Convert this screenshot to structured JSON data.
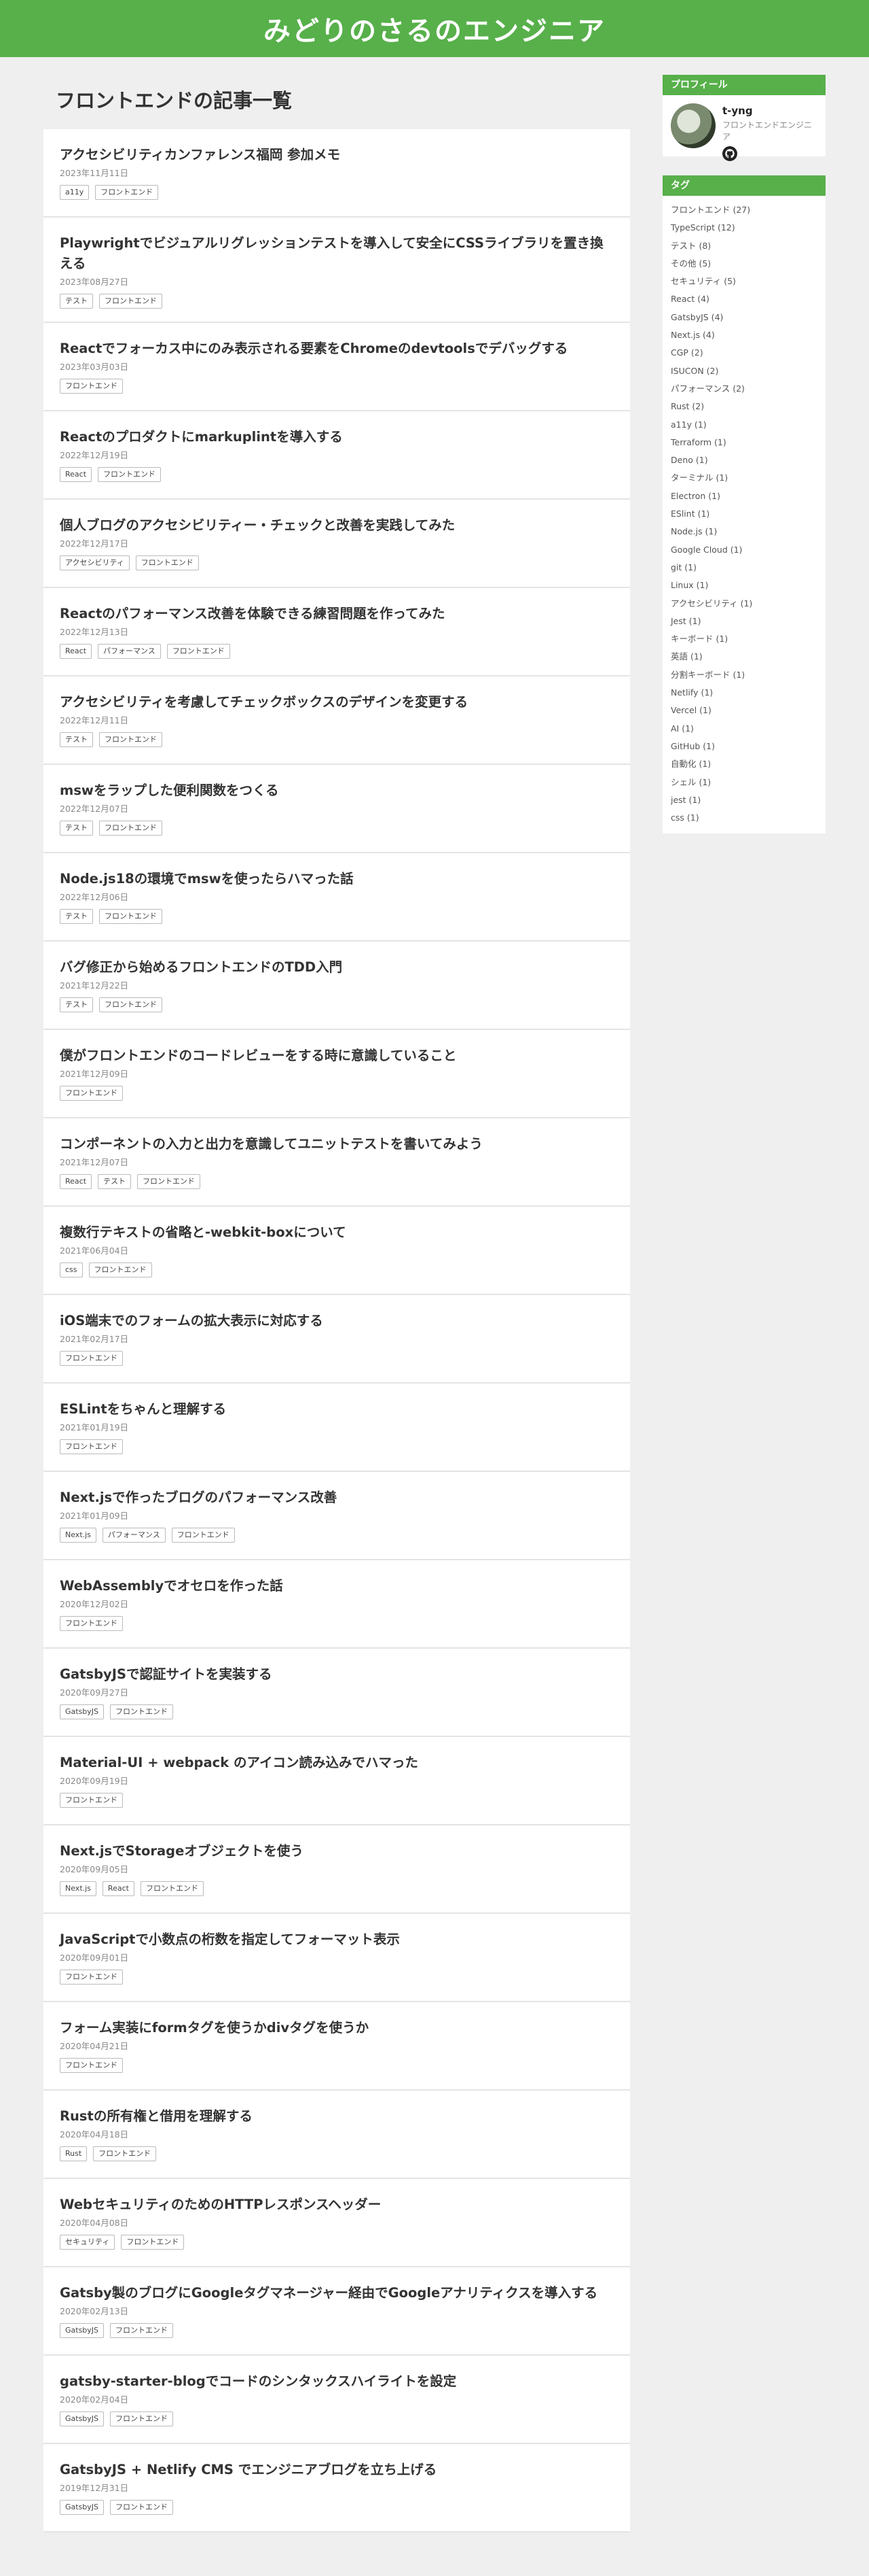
{
  "site": {
    "title": "みどりのさるのエンジニア",
    "accent": "#57b04a"
  },
  "main": {
    "heading": "フロントエンドの記事一覧",
    "articles": [
      {
        "title": "アクセシビリティカンファレンス福岡 参加メモ",
        "date": "2023年11月11日",
        "tags": [
          "a11y",
          "フロントエンド"
        ]
      },
      {
        "title": "Playwrightでビジュアルリグレッションテストを導入して安全にCSSライブラリを置き換える",
        "date": "2023年08月27日",
        "tags": [
          "テスト",
          "フロントエンド"
        ],
        "tall": true
      },
      {
        "title": "Reactでフォーカス中にのみ表示される要素をChromeのdevtoolsでデバッグする",
        "date": "2023年03月03日",
        "tags": [
          "フロントエンド"
        ]
      },
      {
        "title": "Reactのプロダクトにmarkuplintを導入する",
        "date": "2022年12月19日",
        "tags": [
          "React",
          "フロントエンド"
        ]
      },
      {
        "title": "個人ブログのアクセシビリティー・チェックと改善を実践してみた",
        "date": "2022年12月17日",
        "tags": [
          "アクセシビリティ",
          "フロントエンド"
        ]
      },
      {
        "title": "Reactのパフォーマンス改善を体験できる練習問題を作ってみた",
        "date": "2022年12月13日",
        "tags": [
          "React",
          "パフォーマンス",
          "フロントエンド"
        ]
      },
      {
        "title": "アクセシビリティを考慮してチェックボックスのデザインを変更する",
        "date": "2022年12月11日",
        "tags": [
          "テスト",
          "フロントエンド"
        ]
      },
      {
        "title": "mswをラップした便利関数をつくる",
        "date": "2022年12月07日",
        "tags": [
          "テスト",
          "フロントエンド"
        ]
      },
      {
        "title": "Node.js18の環境でmswを使ったらハマった話",
        "date": "2022年12月06日",
        "tags": [
          "テスト",
          "フロントエンド"
        ]
      },
      {
        "title": "バグ修正から始めるフロントエンドのTDD入門",
        "date": "2021年12月22日",
        "tags": [
          "テスト",
          "フロントエンド"
        ]
      },
      {
        "title": "僕がフロントエンドのコードレビューをする時に意識していること",
        "date": "2021年12月09日",
        "tags": [
          "フロントエンド"
        ]
      },
      {
        "title": "コンポーネントの入力と出力を意識してユニットテストを書いてみよう",
        "date": "2021年12月07日",
        "tags": [
          "React",
          "テスト",
          "フロントエンド"
        ]
      },
      {
        "title": "複数行テキストの省略と-webkit-boxについて",
        "date": "2021年06月04日",
        "tags": [
          "css",
          "フロントエンド"
        ]
      },
      {
        "title": "iOS端末でのフォームの拡大表示に対応する",
        "date": "2021年02月17日",
        "tags": [
          "フロントエンド"
        ]
      },
      {
        "title": "ESLintをちゃんと理解する",
        "date": "2021年01月19日",
        "tags": [
          "フロントエンド"
        ]
      },
      {
        "title": "Next.jsで作ったブログのパフォーマンス改善",
        "date": "2021年01月09日",
        "tags": [
          "Next.js",
          "パフォーマンス",
          "フロントエンド"
        ]
      },
      {
        "title": "WebAssemblyでオセロを作った話",
        "date": "2020年12月02日",
        "tags": [
          "フロントエンド"
        ]
      },
      {
        "title": "GatsbyJSで認証サイトを実装する",
        "date": "2020年09月27日",
        "tags": [
          "GatsbyJS",
          "フロントエンド"
        ]
      },
      {
        "title": "Material-UI + webpack のアイコン読み込みでハマった",
        "date": "2020年09月19日",
        "tags": [
          "フロントエンド"
        ]
      },
      {
        "title": "Next.jsでStorageオブジェクトを使う",
        "date": "2020年09月05日",
        "tags": [
          "Next.js",
          "React",
          "フロントエンド"
        ]
      },
      {
        "title": "JavaScriptで小数点の桁数を指定してフォーマット表示",
        "date": "2020年09月01日",
        "tags": [
          "フロントエンド"
        ]
      },
      {
        "title": "フォーム実装にformタグを使うかdivタグを使うか",
        "date": "2020年04月21日",
        "tags": [
          "フロントエンド"
        ]
      },
      {
        "title": "Rustの所有権と借用を理解する",
        "date": "2020年04月18日",
        "tags": [
          "Rust",
          "フロントエンド"
        ]
      },
      {
        "title": "WebセキュリティのためのHTTPレスポンスヘッダー",
        "date": "2020年04月08日",
        "tags": [
          "セキュリティ",
          "フロントエンド"
        ]
      },
      {
        "title": "Gatsby製のブログにGoogleタグマネージャー経由でGoogleアナリティクスを導入する",
        "date": "2020年02月13日",
        "tags": [
          "GatsbyJS",
          "フロントエンド"
        ]
      },
      {
        "title": "gatsby-starter-blogでコードのシンタックスハイライトを設定",
        "date": "2020年02月04日",
        "tags": [
          "GatsbyJS",
          "フロントエンド"
        ]
      },
      {
        "title": "GatsbyJS + Netlify CMS でエンジニアブログを立ち上げる",
        "date": "2019年12月31日",
        "tags": [
          "GatsbyJS",
          "フロントエンド"
        ]
      }
    ]
  },
  "sidebar": {
    "profile": {
      "heading": "プロフィール",
      "name": "t-yng",
      "role": "フロントエンドエンジニア",
      "icon": "github-icon"
    },
    "tags": {
      "heading": "タグ",
      "items": [
        "フロントエンド (27)",
        "TypeScript (12)",
        "テスト (8)",
        "その他 (5)",
        "セキュリティ (5)",
        "React (4)",
        "GatsbyJS (4)",
        "Next.js (4)",
        "CGP (2)",
        "ISUCON (2)",
        "パフォーマンス (2)",
        "Rust (2)",
        "a11y (1)",
        "Terraform (1)",
        "Deno (1)",
        "ターミナル (1)",
        "Electron (1)",
        "ESlint (1)",
        "Node.js (1)",
        "Google Cloud (1)",
        "git (1)",
        "Linux (1)",
        "アクセシビリティ (1)",
        "Jest (1)",
        "キーボード (1)",
        "英語 (1)",
        "分割キーボード (1)",
        "Netlify (1)",
        "Vercel (1)",
        "AI (1)",
        "GitHub (1)",
        "自動化 (1)",
        "シェル (1)",
        "jest (1)",
        "css (1)"
      ]
    }
  }
}
